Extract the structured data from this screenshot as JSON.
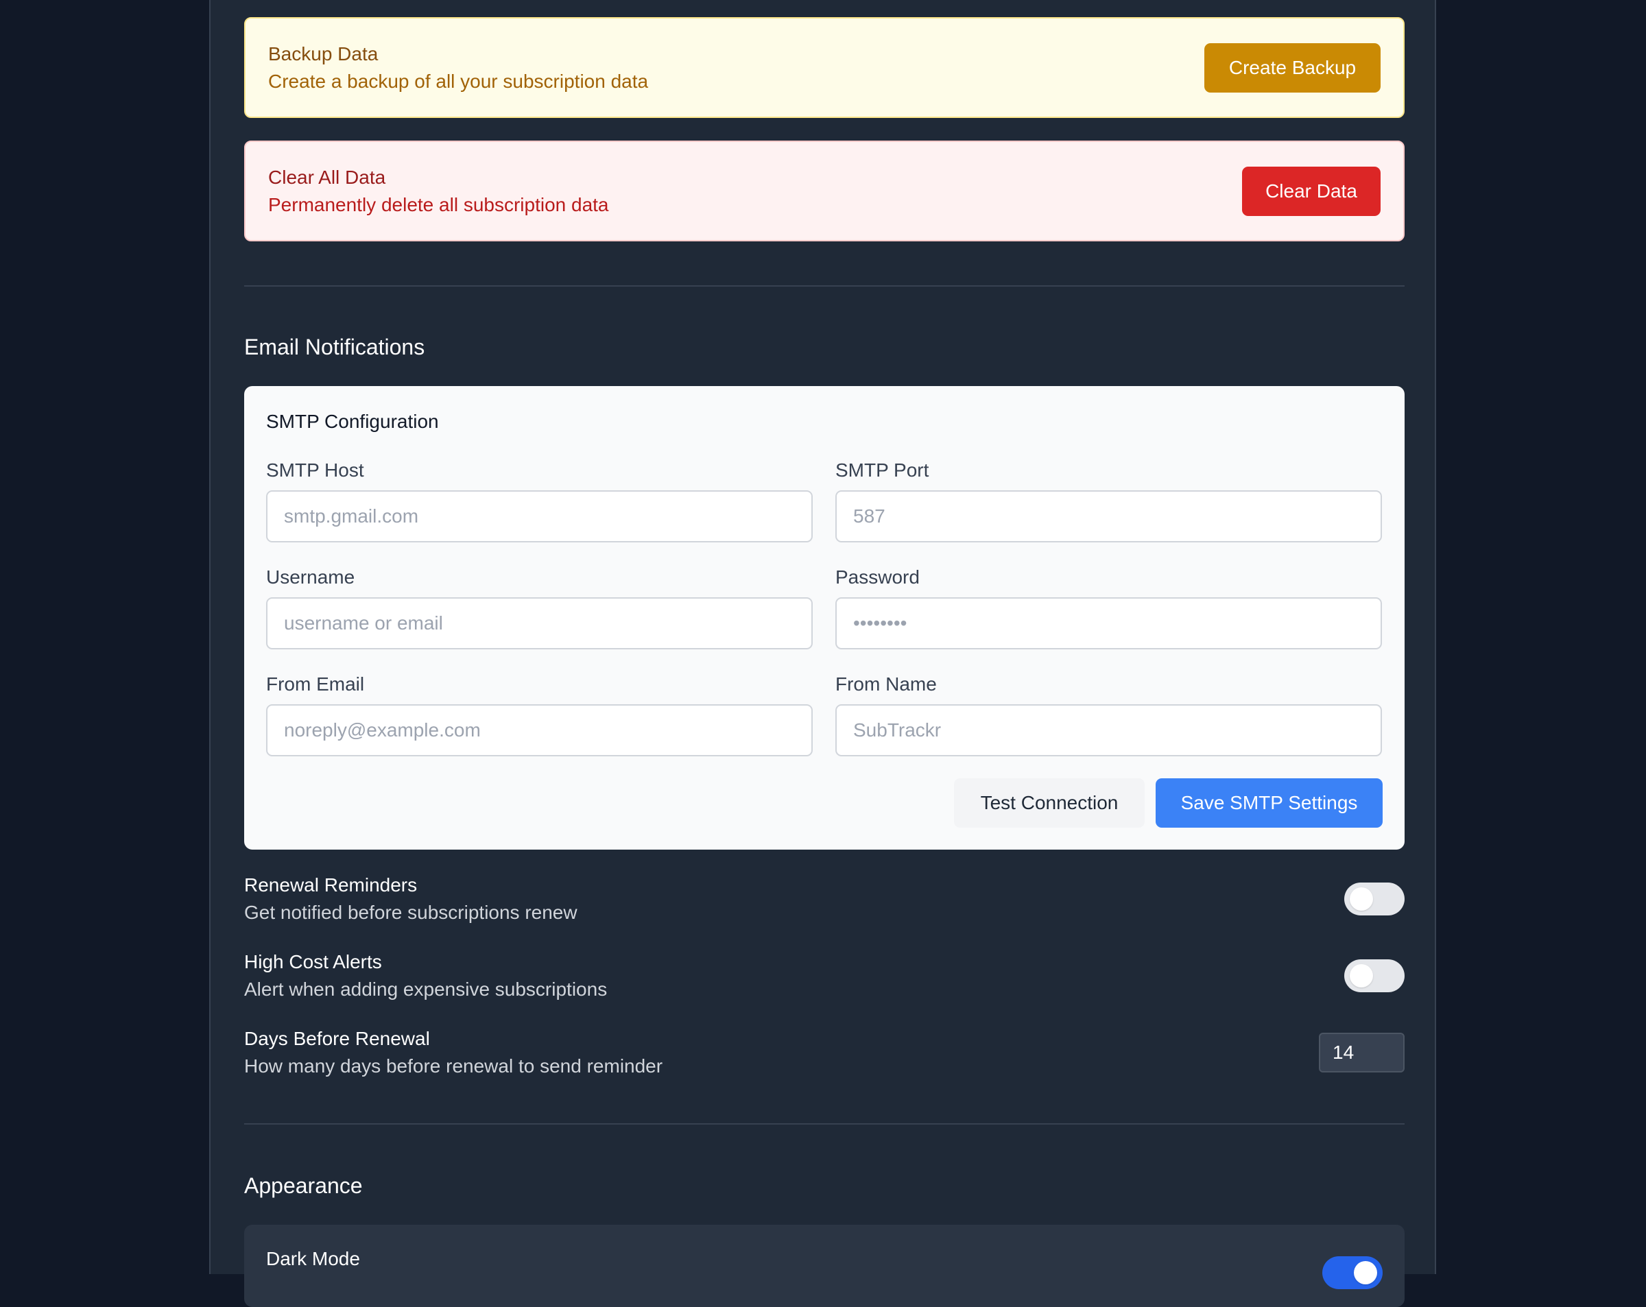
{
  "data_management": {
    "backup": {
      "title": "Backup Data",
      "description": "Create a backup of all your subscription data",
      "button_label": "Create Backup"
    },
    "clear": {
      "title": "Clear All Data",
      "description": "Permanently delete all subscription data",
      "button_label": "Clear Data"
    }
  },
  "email_notifications": {
    "section_title": "Email Notifications",
    "smtp": {
      "title": "SMTP Configuration",
      "host": {
        "label": "SMTP Host",
        "placeholder": "smtp.gmail.com",
        "value": ""
      },
      "port": {
        "label": "SMTP Port",
        "placeholder": "587",
        "value": ""
      },
      "username": {
        "label": "Username",
        "placeholder": "username or email",
        "value": ""
      },
      "password": {
        "label": "Password",
        "placeholder": "••••••••",
        "value": ""
      },
      "from_email": {
        "label": "From Email",
        "placeholder": "noreply@example.com",
        "value": ""
      },
      "from_name": {
        "label": "From Name",
        "placeholder": "SubTrackr",
        "value": ""
      },
      "test_button_label": "Test Connection",
      "save_button_label": "Save SMTP Settings"
    },
    "renewal_reminders": {
      "title": "Renewal Reminders",
      "description": "Get notified before subscriptions renew",
      "enabled": false
    },
    "high_cost_alerts": {
      "title": "High Cost Alerts",
      "description": "Alert when adding expensive subscriptions",
      "enabled": false
    },
    "days_before_renewal": {
      "title": "Days Before Renewal",
      "description": "How many days before renewal to send reminder",
      "value": "14"
    }
  },
  "appearance": {
    "section_title": "Appearance",
    "dark_mode": {
      "title": "Dark Mode",
      "enabled": true
    }
  },
  "colors": {
    "page_background": "#111827",
    "panel_background": "#1f2937",
    "warning_button": "#ca8a04",
    "danger_button": "#dc2626",
    "primary_button": "#3b82f6",
    "toggle_on": "#2563eb"
  }
}
